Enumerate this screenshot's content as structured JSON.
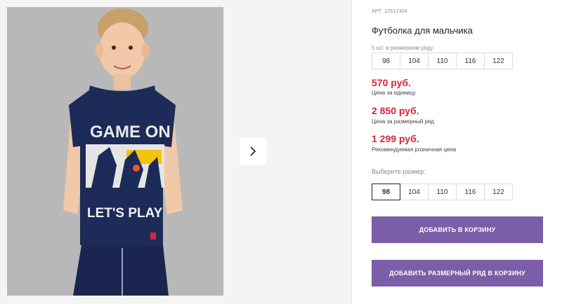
{
  "product": {
    "article": "АРТ: 12512304",
    "title": "Футболка для мальчика",
    "pack_hint": "5 шт. в размерном ряду",
    "pack_sizes": [
      "98",
      "104",
      "110",
      "116",
      "122"
    ],
    "prices": [
      {
        "value": "570 руб.",
        "label": "Цена за единицу"
      },
      {
        "value": "2 850 руб.",
        "label": "Цена за размерный ряд"
      },
      {
        "value": "1 299 руб.",
        "label": "Рекомендуемая розничная цена"
      }
    ],
    "choose_label": "Выберите размер:",
    "sizes": [
      "98",
      "104",
      "110",
      "116",
      "122"
    ],
    "selected_size": "98",
    "add_to_cart": "ДОБАВИТЬ В КОРЗИНУ",
    "add_pack_to_cart": "ДОБАВИТЬ РАЗМЕРНЫЙ РЯД В КОРЗИНУ"
  },
  "image": {
    "shirt_text_top": "GAME ON",
    "shirt_text_bottom": "LET'S PLAY"
  },
  "colors": {
    "price": "#d7263d",
    "button": "#7b5ea7",
    "shirt": "#1c2b57"
  }
}
